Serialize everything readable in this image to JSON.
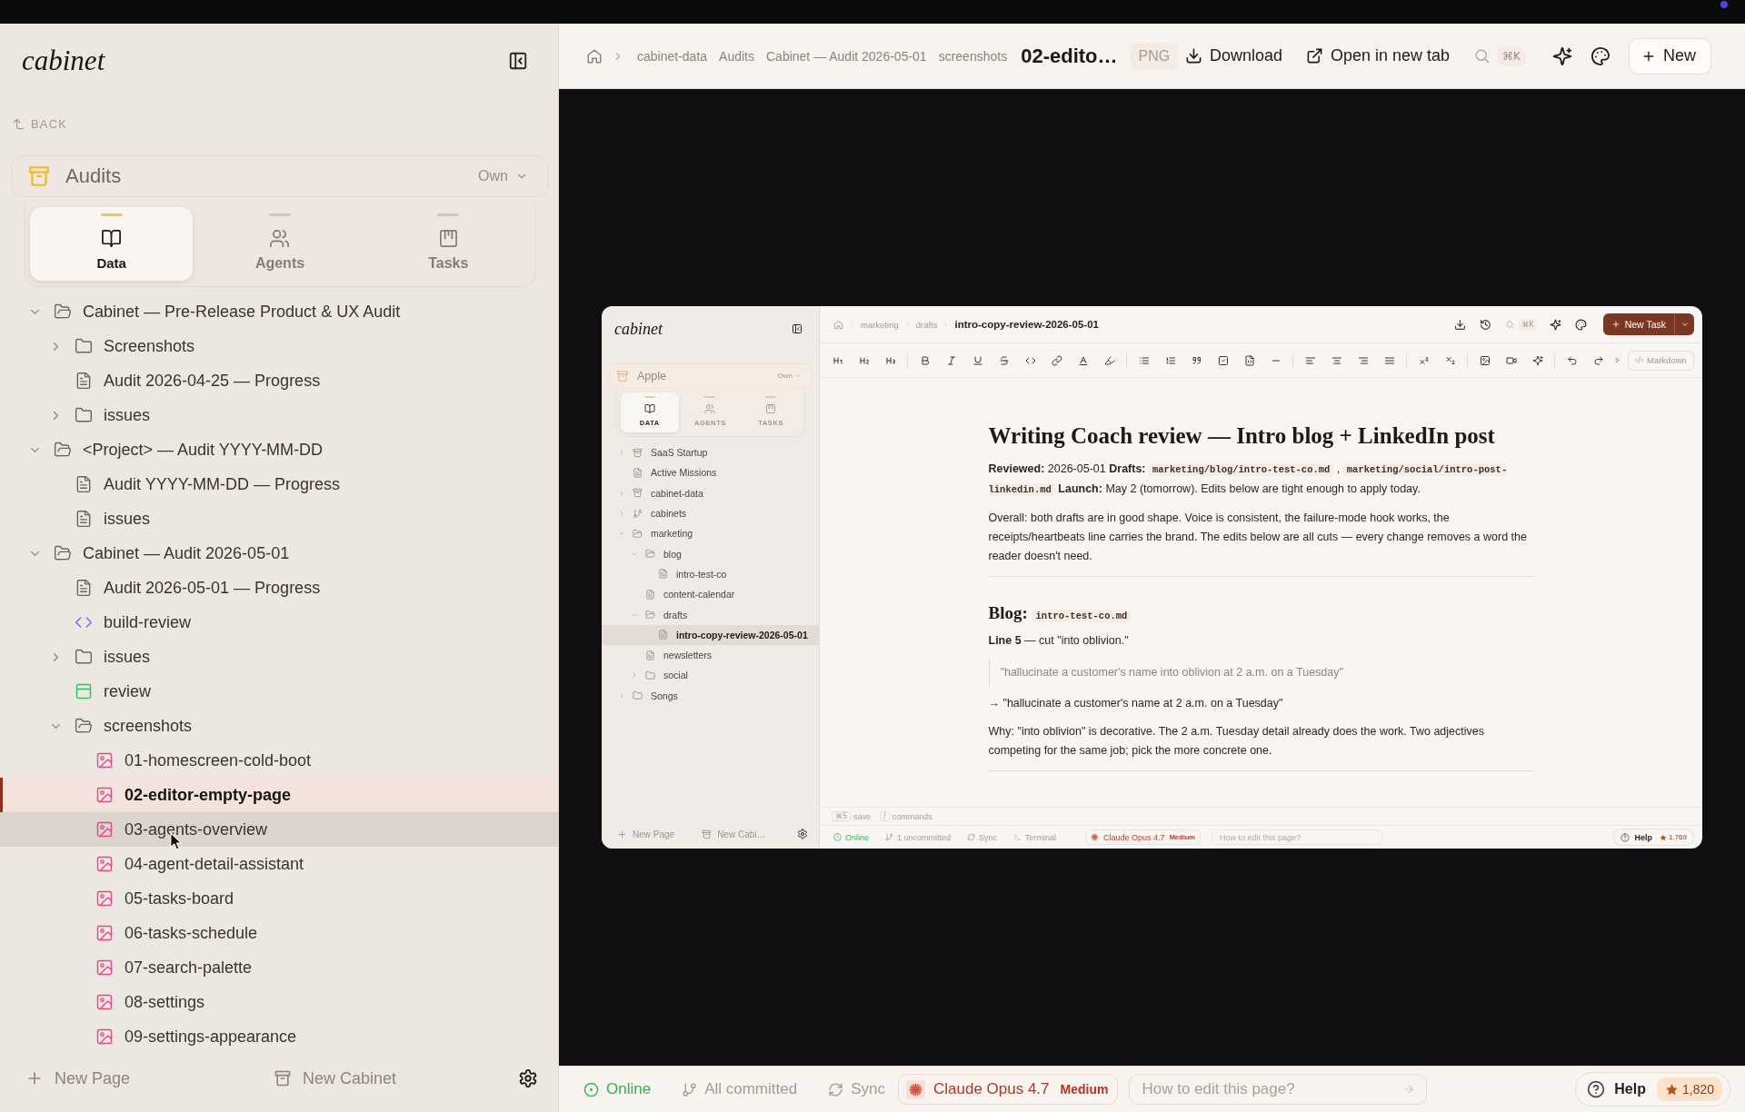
{
  "sidebar": {
    "logo": "cabinet",
    "back": "BACK",
    "cabinet": {
      "name": "Audits",
      "scope": "Own"
    },
    "tabs": [
      {
        "label": "Data",
        "selected": true
      },
      {
        "label": "Agents",
        "selected": false
      },
      {
        "label": "Tasks",
        "selected": false
      }
    ],
    "tree": [
      {
        "label": "Cabinet — Pre-Release Product & UX Audit",
        "kind": "folder",
        "expanded": true,
        "selected": false,
        "hovered": false,
        "children": [
          {
            "label": "Screenshots",
            "kind": "folder",
            "expanded": false,
            "selected": false,
            "hovered": false
          },
          {
            "label": "Audit 2026-04-25 — Progress",
            "kind": "doc",
            "selected": false,
            "hovered": false
          },
          {
            "label": "issues",
            "kind": "folder",
            "expanded": false,
            "selected": false,
            "hovered": false
          }
        ]
      },
      {
        "label": "<Project> — Audit YYYY-MM-DD",
        "kind": "folder",
        "expanded": true,
        "selected": false,
        "hovered": false,
        "children": [
          {
            "label": "Audit YYYY-MM-DD — Progress",
            "kind": "doc",
            "selected": false,
            "hovered": false
          },
          {
            "label": "issues",
            "kind": "doc",
            "selected": false,
            "hovered": false
          }
        ]
      },
      {
        "label": "Cabinet — Audit 2026-05-01",
        "kind": "folder",
        "expanded": true,
        "selected": false,
        "hovered": false,
        "children": [
          {
            "label": "Audit 2026-05-01 — Progress",
            "kind": "doc",
            "selected": false,
            "hovered": false
          },
          {
            "label": "build-review",
            "kind": "code",
            "selected": false,
            "hovered": false
          },
          {
            "label": "issues",
            "kind": "folder",
            "expanded": false,
            "selected": false,
            "hovered": false
          },
          {
            "label": "review",
            "kind": "table",
            "selected": false,
            "hovered": false
          },
          {
            "label": "screenshots",
            "kind": "folder",
            "expanded": true,
            "selected": false,
            "hovered": false,
            "children": [
              {
                "label": "01-homescreen-cold-boot",
                "kind": "image",
                "selected": false,
                "hovered": false
              },
              {
                "label": "02-editor-empty-page",
                "kind": "image",
                "selected": true,
                "hovered": false
              },
              {
                "label": "03-agents-overview",
                "kind": "image",
                "selected": false,
                "hovered": true
              },
              {
                "label": "04-agent-detail-assistant",
                "kind": "image",
                "selected": false,
                "hovered": false
              },
              {
                "label": "05-tasks-board",
                "kind": "image",
                "selected": false,
                "hovered": false
              },
              {
                "label": "06-tasks-schedule",
                "kind": "image",
                "selected": false,
                "hovered": false
              },
              {
                "label": "07-search-palette",
                "kind": "image",
                "selected": false,
                "hovered": false
              },
              {
                "label": "08-settings",
                "kind": "image",
                "selected": false,
                "hovered": false
              },
              {
                "label": "09-settings-appearance",
                "kind": "image",
                "selected": false,
                "hovered": false
              }
            ]
          }
        ]
      }
    ],
    "footer": {
      "new_page": "New Page",
      "new_cabinet": "New Cabinet"
    }
  },
  "toolbar": {
    "breadcrumbs": [
      "cabinet-data",
      "Audits",
      "Cabinet — Audit 2026-05-01",
      "screenshots"
    ],
    "current": "02-edito…",
    "file_type": "PNG",
    "download": "Download",
    "open_in_new_tab": "Open in new tab",
    "shortcut": "⌘K",
    "new": "New"
  },
  "preview": {
    "sidebar": {
      "logo": "cabinet",
      "cabinet": {
        "name": "Apple",
        "scope": "Own"
      },
      "tabs": [
        {
          "label": "DATA",
          "selected": true
        },
        {
          "label": "AGENTS",
          "selected": false
        },
        {
          "label": "TASKS",
          "selected": false
        }
      ],
      "tree": [
        {
          "label": "SaaS Startup",
          "kind": "cabinet",
          "expanded": false,
          "selected": false
        },
        {
          "label": "Active Missions",
          "kind": "doc",
          "selected": false
        },
        {
          "label": "cabinet-data",
          "kind": "cabinet",
          "expanded": false,
          "selected": false
        },
        {
          "label": "cabinets",
          "kind": "branch",
          "expanded": false,
          "selected": false
        },
        {
          "label": "marketing",
          "kind": "folder",
          "expanded": true,
          "selected": false,
          "children": [
            {
              "label": "blog",
              "kind": "folder",
              "expanded": true,
              "selected": false,
              "children": [
                {
                  "label": "intro-test-co",
                  "kind": "doc",
                  "selected": false
                }
              ]
            },
            {
              "label": "content-calendar",
              "kind": "doc",
              "selected": false
            },
            {
              "label": "drafts",
              "kind": "folder",
              "expanded": true,
              "selected": false,
              "children": [
                {
                  "label": "intro-copy-review-2026-05-01",
                  "kind": "doc",
                  "selected": true
                }
              ]
            },
            {
              "label": "newsletters",
              "kind": "doc",
              "selected": false
            },
            {
              "label": "social",
              "kind": "folder",
              "expanded": false,
              "selected": false
            }
          ]
        },
        {
          "label": "Songs",
          "kind": "folder",
          "expanded": false,
          "selected": false
        }
      ],
      "footer": {
        "new_page": "New Page",
        "new_cabinet": "New Cabi…"
      }
    },
    "toolbar": {
      "breadcrumbs": [
        "marketing",
        "drafts"
      ],
      "current": "intro-copy-review-2026-05-01",
      "shortcut": "⌘K",
      "new_task": "New Task",
      "markdown": "Markdown"
    },
    "document": {
      "title": "Writing Coach review — Intro blog + LinkedIn post",
      "blocks": [
        {
          "kind": "paragraph",
          "segments": [
            {
              "kind": "text",
              "text": "**Reviewed:** 2026-05-01 **Drafts:** "
            },
            {
              "kind": "code",
              "text": "marketing/blog/intro-test-co.md"
            },
            {
              "kind": "text",
              "text": " , "
            },
            {
              "kind": "code",
              "text": "marketing/social/intro-post-linkedin.md"
            },
            {
              "kind": "text",
              "text": " **Launch:** May 2 (tomorrow). Edits below are tight enough to apply today."
            }
          ]
        },
        {
          "kind": "paragraph",
          "segments": [
            {
              "kind": "text",
              "text": "Overall: both drafts are in good shape. Voice is consistent, the failure-mode hook works, the receipts/heartbeats line carries the brand. The edits below are all cuts — every change removes a word the reader doesn't need."
            }
          ]
        },
        {
          "kind": "rule"
        },
        {
          "kind": "heading",
          "segments": [
            {
              "kind": "text",
              "text": "Blog: "
            },
            {
              "kind": "code",
              "text": "intro-test-co.md"
            }
          ]
        },
        {
          "kind": "paragraph",
          "segments": [
            {
              "kind": "text",
              "text": "**Line 5** — cut \"into oblivion.\""
            }
          ]
        },
        {
          "kind": "quote",
          "segments": [
            {
              "kind": "text",
              "text": "\"hallucinate a customer's name into oblivion at 2 a.m. on a Tuesday\""
            }
          ]
        },
        {
          "kind": "paragraph",
          "segments": [
            {
              "kind": "text",
              "text": "→ \"hallucinate a customer's name at 2 a.m. on a Tuesday\""
            }
          ]
        },
        {
          "kind": "paragraph",
          "segments": [
            {
              "kind": "text",
              "text": "Why: \"into oblivion\" is decorative. The 2 a.m. Tuesday detail already does the work. Two adjectives competing for the same job; pick the more concrete one."
            }
          ]
        },
        {
          "kind": "rule"
        }
      ]
    },
    "hints": [
      {
        "key": "⌘S",
        "label": "save"
      },
      {
        "key": "/",
        "label": "commands"
      }
    ],
    "status_bar": {
      "online": "Online",
      "git": "1 uncommitted",
      "sync": "Sync",
      "terminal": "Terminal",
      "model": "Claude Opus 4.7",
      "effort": "Medium",
      "prompt": {
        "placeholder": "How to edit this page?"
      },
      "help": "Help",
      "badge_count": "1,769"
    }
  },
  "status_bar": {
    "online": "Online",
    "git": "All committed",
    "sync": "Sync",
    "model": "Claude Opus 4.7",
    "effort": "Medium",
    "prompt": {
      "placeholder": "How to edit this page?"
    },
    "help": "Help",
    "badge_count": "1,820"
  }
}
